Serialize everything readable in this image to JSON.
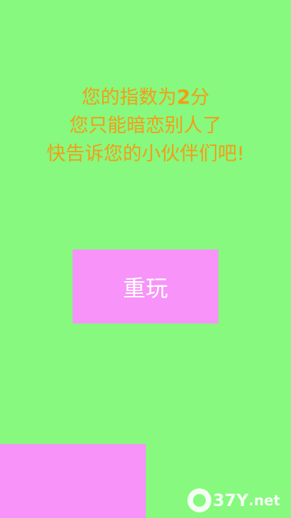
{
  "result": {
    "line1_prefix": "您的指数为",
    "score": "2",
    "line1_suffix": "分",
    "line2": "您只能暗恋别人了",
    "line3": "快告诉您的小伙伴们吧!"
  },
  "replay_button": {
    "label": "重玩"
  },
  "watermark": {
    "text": "37Y",
    "suffix": ".net"
  },
  "colors": {
    "background": "#86f97e",
    "text_orange": "#f59d16",
    "block_pink": "#f793f9",
    "button_text": "#ffffff"
  }
}
